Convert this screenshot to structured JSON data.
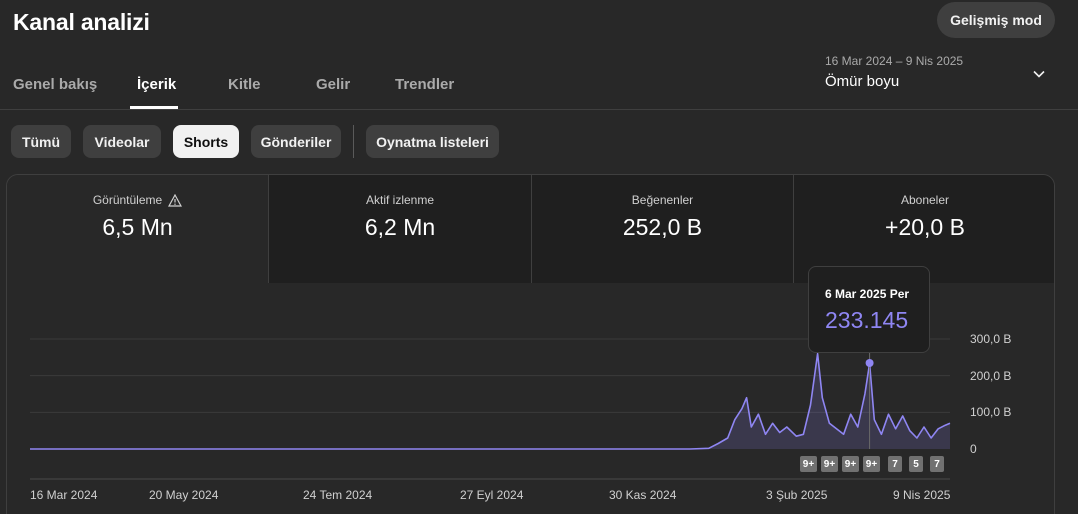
{
  "header": {
    "title": "Kanal analizi",
    "advanced_mode_label": "Gelişmiş mod"
  },
  "tabs": [
    {
      "label": "Genel bakış",
      "active": false
    },
    {
      "label": "İçerik",
      "active": true
    },
    {
      "label": "Kitle",
      "active": false
    },
    {
      "label": "Gelir",
      "active": false
    },
    {
      "label": "Trendler",
      "active": false
    }
  ],
  "date_picker": {
    "range": "16 Mar 2024 – 9 Nis 2025",
    "preset": "Ömür boyu",
    "icon": "chevron-down-icon"
  },
  "filters": [
    {
      "label": "Tümü",
      "active": false
    },
    {
      "label": "Videolar",
      "active": false
    },
    {
      "label": "Shorts",
      "active": true
    },
    {
      "label": "Gönderiler",
      "active": false
    },
    {
      "label": "Oynatma listeleri",
      "active": false
    }
  ],
  "metrics": [
    {
      "label": "Görüntüleme",
      "value": "6,5 Mn",
      "active": true,
      "warning_icon": "warning-triangle-icon"
    },
    {
      "label": "Aktif izlenme",
      "value": "6,2 Mn",
      "active": false
    },
    {
      "label": "Beğenenler",
      "value": "252,0 B",
      "active": false
    },
    {
      "label": "Aboneler",
      "value": "+20,0 B",
      "active": false
    }
  ],
  "tooltip": {
    "date": "6 Mar 2025 Per",
    "value": "233.145"
  },
  "badges": [
    "9+",
    "9+",
    "9+",
    "9+",
    "7",
    "5",
    "7"
  ],
  "colors": {
    "line": "#8f86f3",
    "background": "#282828",
    "chip_active": "#f1f1f1"
  },
  "chart_data": {
    "type": "line",
    "y_tick_labels": [
      "300,0 B",
      "200,0 B",
      "100,0 B",
      "0"
    ],
    "x_tick_labels": [
      "16 Mar 2024",
      "20 May 2024",
      "24 Tem 2024",
      "27 Eyl 2024",
      "30 Kas 2024",
      "3 Şub 2025",
      "9 Nis 2025"
    ],
    "ylim": [
      0,
      300000
    ],
    "xlim": [
      "2024-03-16",
      "2025-04-09"
    ],
    "grid": true,
    "series": [
      {
        "points": [
          [
            "2024-03-16",
            0
          ],
          [
            "2024-12-20",
            0
          ],
          [
            "2024-12-28",
            2000
          ],
          [
            "2025-01-01",
            15000
          ],
          [
            "2025-01-05",
            30000
          ],
          [
            "2025-01-08",
            80000
          ],
          [
            "2025-01-11",
            110000
          ],
          [
            "2025-01-13",
            140000
          ],
          [
            "2025-01-15",
            60000
          ],
          [
            "2025-01-18",
            95000
          ],
          [
            "2025-01-21",
            40000
          ],
          [
            "2025-01-24",
            70000
          ],
          [
            "2025-01-27",
            45000
          ],
          [
            "2025-01-30",
            60000
          ],
          [
            "2025-02-03",
            35000
          ],
          [
            "2025-02-06",
            40000
          ],
          [
            "2025-02-09",
            120000
          ],
          [
            "2025-02-12",
            260000
          ],
          [
            "2025-02-14",
            140000
          ],
          [
            "2025-02-17",
            70000
          ],
          [
            "2025-02-20",
            55000
          ],
          [
            "2025-02-23",
            40000
          ],
          [
            "2025-02-26",
            95000
          ],
          [
            "2025-03-01",
            60000
          ],
          [
            "2025-03-04",
            150000
          ],
          [
            "2025-03-06",
            233145
          ],
          [
            "2025-03-08",
            80000
          ],
          [
            "2025-03-11",
            40000
          ],
          [
            "2025-03-14",
            95000
          ],
          [
            "2025-03-17",
            55000
          ],
          [
            "2025-03-20",
            90000
          ],
          [
            "2025-03-23",
            50000
          ],
          [
            "2025-03-26",
            30000
          ],
          [
            "2025-03-29",
            60000
          ],
          [
            "2025-04-01",
            30000
          ],
          [
            "2025-04-04",
            55000
          ],
          [
            "2025-04-07",
            65000
          ],
          [
            "2025-04-09",
            70000
          ]
        ],
        "highlight": {
          "x": "2025-03-06",
          "y": 233145
        }
      }
    ]
  }
}
